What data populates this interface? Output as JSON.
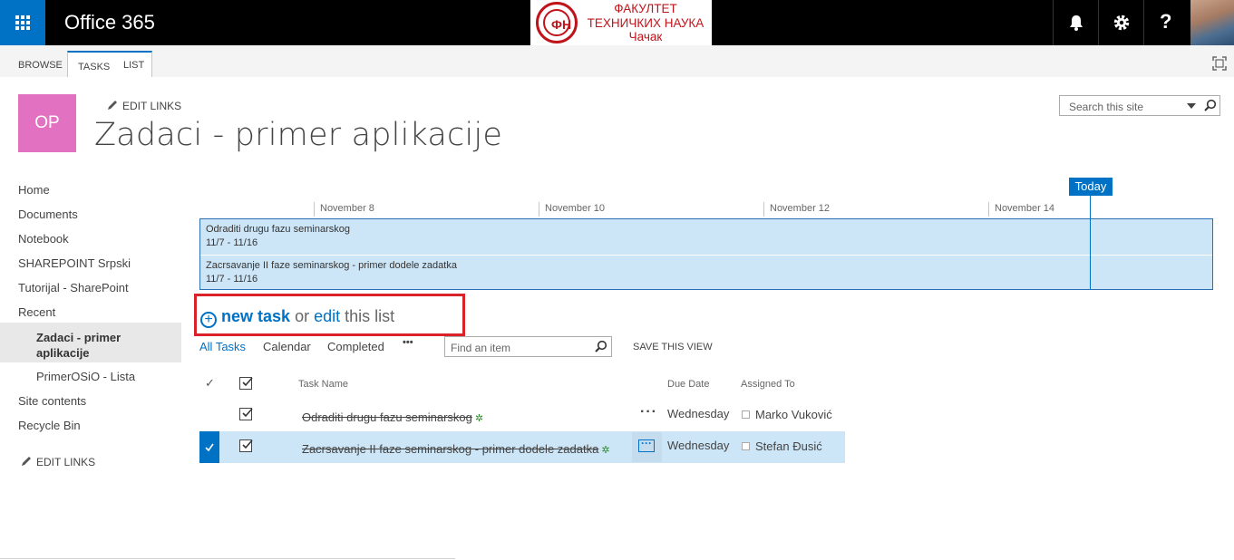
{
  "suite": {
    "title": "Office 365"
  },
  "logo": {
    "line1": "ФАКУЛТЕТ",
    "line2": "ТЕХНИЧКИХ НАУКА",
    "line3": "Чачак",
    "seal_glyph": "ФН"
  },
  "ribbon": {
    "tabs": [
      "BROWSE",
      "TASKS",
      "LIST"
    ],
    "active_tab": "TASKS"
  },
  "site": {
    "tile": "OP",
    "edit_links": "EDIT LINKS",
    "title": "Zadaci - primer aplikacije",
    "search_placeholder": "Search this site"
  },
  "nav": {
    "items": [
      "Home",
      "Documents",
      "Notebook",
      "SHAREPOINT Srpski",
      "Tutorijal - SharePoint",
      "Recent"
    ],
    "recent": [
      "Zadaci - primer aplikacije",
      "PrimerOSiO - Lista"
    ],
    "items_after": [
      "Site contents",
      "Recycle Bin"
    ],
    "edit_links": "EDIT LINKS"
  },
  "timeline": {
    "today_label": "Today",
    "dates": [
      "November 8",
      "November 10",
      "November 12",
      "November 14"
    ],
    "bars": [
      {
        "name": "Odraditi drugu fazu seminarskog",
        "range": "11/7 - 11/16"
      },
      {
        "name": "Zacrsavanje II faze seminarskog - primer dodele zadatka",
        "range": "11/7 - 11/16"
      }
    ]
  },
  "newtask": {
    "new_task": "new task",
    "or": "or",
    "edit": "edit",
    "this_list": "this list"
  },
  "views": {
    "tabs": [
      "All Tasks",
      "Calendar",
      "Completed"
    ],
    "more": "•••",
    "find_placeholder": "Find an item",
    "save_view": "SAVE THIS VIEW"
  },
  "list": {
    "columns": {
      "task_name": "Task Name",
      "due_date": "Due Date",
      "assigned_to": "Assigned To"
    },
    "rows": [
      {
        "task": "Odraditi drugu fazu seminarskog",
        "due": "Wednesday",
        "assigned": "Marko Vuković",
        "completed": true,
        "selected": false
      },
      {
        "task": "Zacrsavanje II faze seminarskog - primer dodele zadatka",
        "due": "Wednesday",
        "assigned": "Stefan Đusić",
        "completed": true,
        "selected": true
      }
    ]
  },
  "colors": {
    "brand_blue": "#0072c6",
    "tile_pink": "#e272c1",
    "highlight_red": "#d9222a",
    "timeline_fill": "#cde6f7"
  }
}
